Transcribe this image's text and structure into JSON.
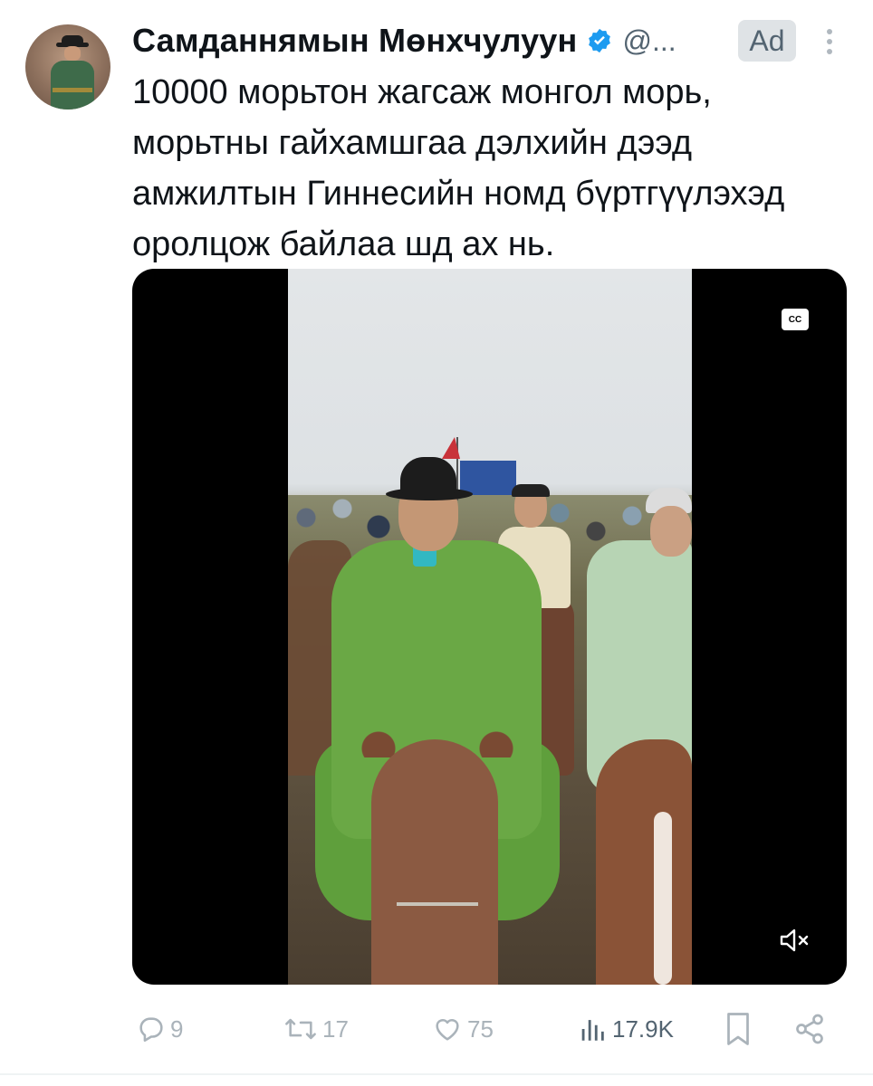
{
  "author": {
    "name": "Самданнямын Мөнхчулуун",
    "handle": "@...",
    "verified": true,
    "avatar_icon": "avatar-photo"
  },
  "badge": {
    "label": "Ad"
  },
  "menu": {
    "icon": "vertical-dots-icon"
  },
  "tweet": {
    "text": "10000 морьтон жагсаж монгол морь,\nморьтны гайхамшгаа дэлхийн дээд\nамжилтын Гиннесийн номд бүртгүүлэхэд\nоролцож байлаа шд ах нь."
  },
  "media": {
    "type": "video",
    "cc_label": "CC",
    "mute_icon": "speaker-muted-icon"
  },
  "actions": {
    "replies": "9",
    "retweets": "17",
    "likes": "75",
    "views": "17.9K"
  },
  "colors": {
    "verified": "#1d9bf0",
    "muted_text": "#536471",
    "action_gray": "#aab3ba",
    "ad_badge_bg": "#dfe3e6"
  }
}
